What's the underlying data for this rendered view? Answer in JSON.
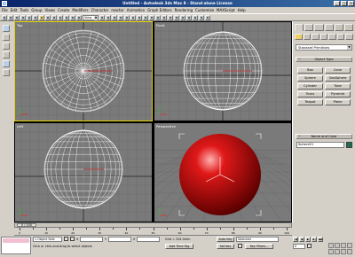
{
  "window": {
    "title": "Untitled - Autodesk 3ds Max 8 - Stand-alone License",
    "minimize": "_",
    "maximize": "□",
    "close": "×"
  },
  "menu": [
    "File",
    "Edit",
    "Tools",
    "Group",
    "Views",
    "Create",
    "Modifiers",
    "Character",
    "reactor",
    "Animation",
    "Graph Editors",
    "Rendering",
    "Customize",
    "MAXScript",
    "Help"
  ],
  "toolbar": {
    "coord_dropdown": "View"
  },
  "viewports": {
    "top": "Top",
    "front": "Front",
    "left": "Left",
    "perspective": "Perspective"
  },
  "command_panel": {
    "category_dropdown": "Standard Primitives",
    "object_type_header": "Object Type",
    "autogrid_label": "AutoGrid",
    "object_buttons": [
      "Box",
      "Cone",
      "Sphere",
      "GeoSphere",
      "Cylinder",
      "Tube",
      "Torus",
      "Pyramid",
      "Teapot",
      "Plane"
    ],
    "name_color_header": "Name and Color",
    "object_name": "Sphere01",
    "object_color": "#1f6e4e"
  },
  "timeline": {
    "frame_display": "0 / 100",
    "ticks": [
      "0",
      "10",
      "20",
      "30",
      "40",
      "50",
      "60",
      "70",
      "80",
      "90",
      "100"
    ]
  },
  "status": {
    "selection": "1 Object Sele",
    "x_label": "X",
    "y_label": "Y",
    "z_label": "Z",
    "grid": "Grid = 254.0mm",
    "prompt": "Click or click-and-drag to select objects",
    "add_time_tag": "Add Time Tag",
    "auto_key": "Auto Key",
    "selected": "Selected",
    "set_key": "Set Key",
    "key_filters": "Key Filters...",
    "frame": "0"
  }
}
